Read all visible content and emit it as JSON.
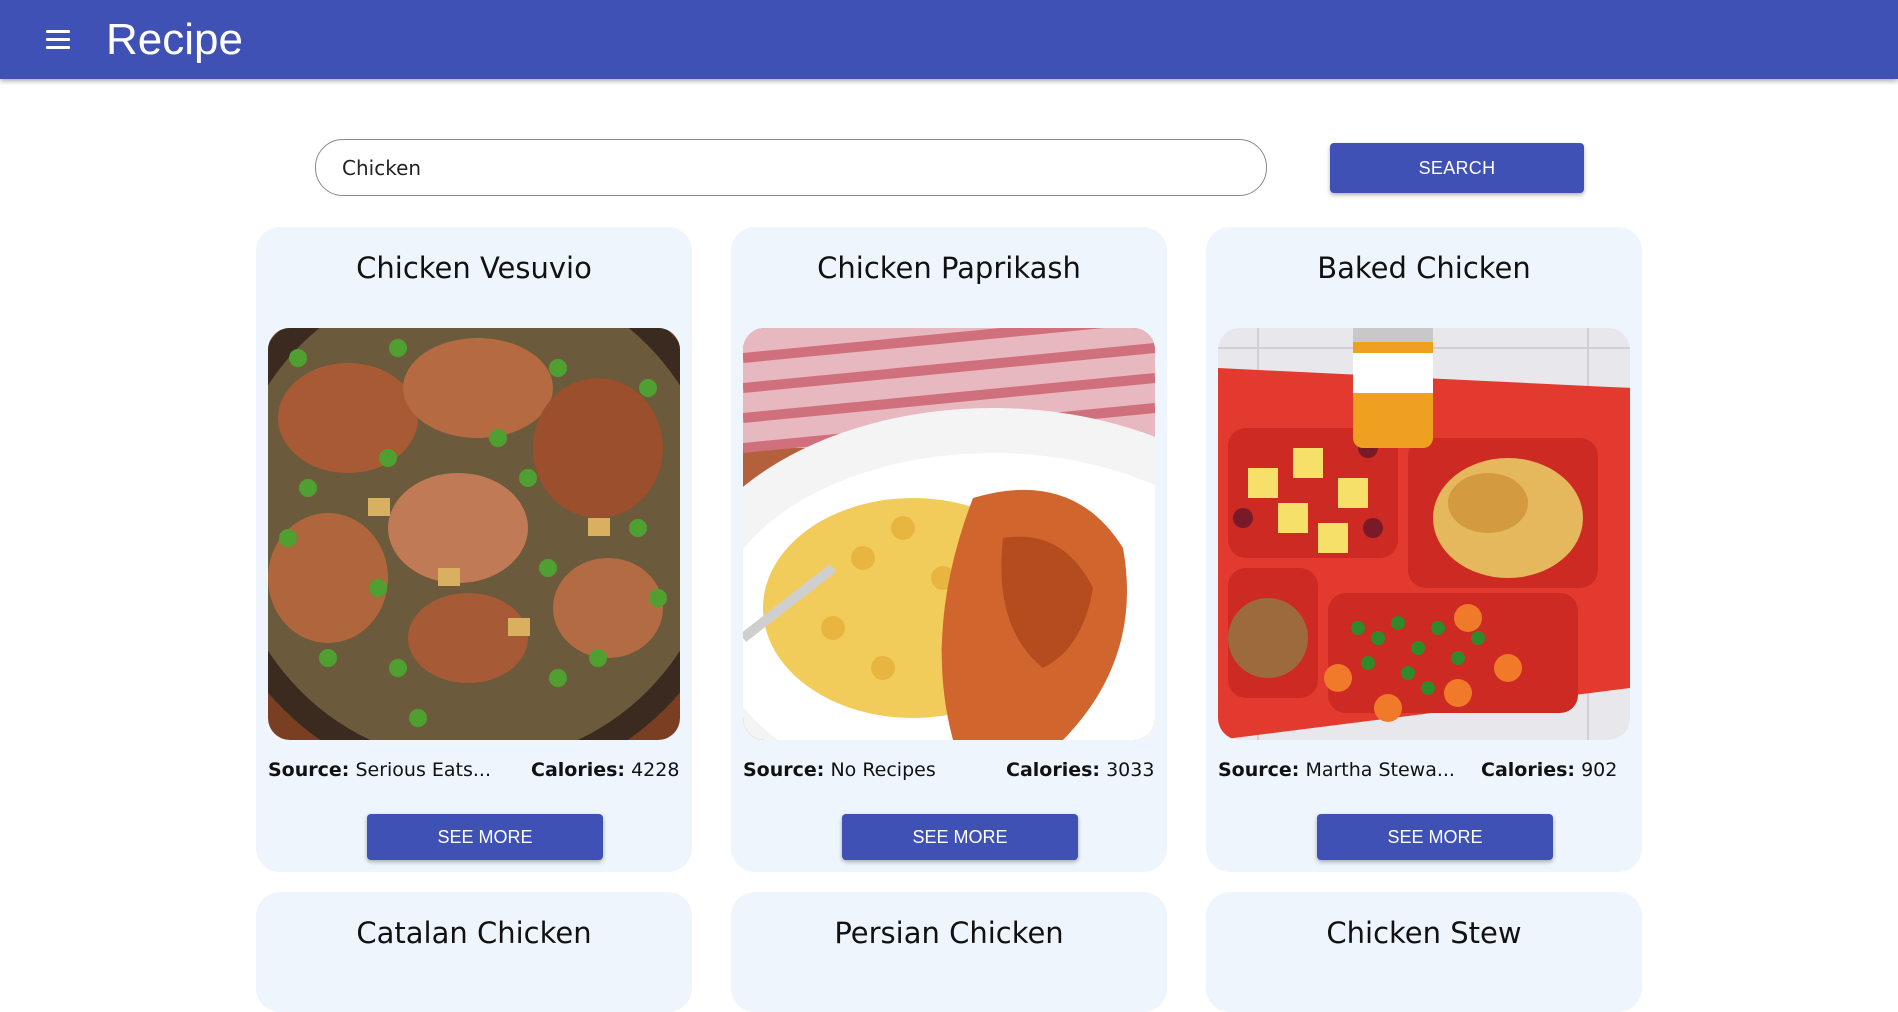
{
  "app": {
    "title": "Recipe",
    "menu_icon": "hamburger-menu-icon"
  },
  "search": {
    "value": "Chicken",
    "button_label": "SEARCH"
  },
  "labels": {
    "source": "Source:",
    "calories": "Calories:",
    "see_more": "SEE MORE"
  },
  "recipes": [
    {
      "title": "Chicken Vesuvio",
      "source": "Serious Eats...",
      "calories": "4228",
      "image": "chicken-vesuvio-photo"
    },
    {
      "title": "Chicken Paprikash",
      "source": "No Recipes",
      "calories": "3033",
      "image": "chicken-paprikash-photo"
    },
    {
      "title": "Baked Chicken",
      "source": "Martha Stewa...",
      "calories": "902",
      "image": "baked-chicken-tray-photo"
    },
    {
      "title": "Catalan Chicken"
    },
    {
      "title": "Persian Chicken"
    },
    {
      "title": "Chicken Stew"
    }
  ],
  "colors": {
    "primary": "#3f51b5",
    "card_background": "#eef5fd"
  }
}
